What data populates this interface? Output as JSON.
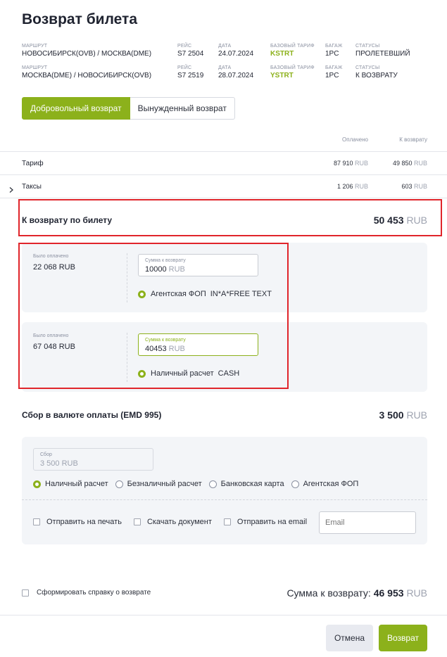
{
  "title": "Возврат билета",
  "flights": [
    {
      "route_label": "МАРШРУТ",
      "route": "НОВОСИБИРСК(OVB) / МОСКВА(DME)",
      "flight_label": "РЕЙС",
      "flight": "S7 2504",
      "date_label": "ДАТА",
      "date": "24.07.2024",
      "fare_label": "БАЗОВЫЙ ТАРИФ",
      "fare": "KSTRT",
      "baggage_label": "БАГАЖ",
      "baggage": "1PC",
      "status_label": "СТАТУСЫ",
      "status": "ПРОЛЕТЕВШИЙ"
    },
    {
      "route_label": "МАРШРУТ",
      "route": "МОСКВА(DME) / НОВОСИБИРСК(OVB)",
      "flight_label": "РЕЙС",
      "flight": "S7 2519",
      "date_label": "ДАТА",
      "date": "28.07.2024",
      "fare_label": "БАЗОВЫЙ ТАРИФ",
      "fare": "YSTRT",
      "baggage_label": "БАГАЖ",
      "baggage": "1PC",
      "status_label": "СТАТУСЫ",
      "status": "К ВОЗВРАТУ"
    }
  ],
  "tabs": {
    "voluntary": "Добровольный возврат",
    "forced": "Вынужденный возврат"
  },
  "table": {
    "col_paid": "Оплачено",
    "col_refund": "К возврату",
    "rows": [
      {
        "name": "Тариф",
        "paid": "87 910",
        "refund": "49 850"
      },
      {
        "name": "Таксы",
        "paid": "1 206",
        "refund": "603"
      }
    ],
    "currency": "RUB"
  },
  "ticket_refund": {
    "label": "К возврату по билету",
    "amount": "50 453",
    "currency": "RUB"
  },
  "payments": [
    {
      "paid_label": "Было оплачено",
      "paid": "22 068 RUB",
      "input_label": "Сумма к возврату",
      "input_value": "10000",
      "input_currency": "RUB",
      "method": "Агентская ФОП",
      "method_code": "IN*A*FREE TEXT"
    },
    {
      "paid_label": "Было оплачено",
      "paid": "67 048 RUB",
      "input_label": "Сумма к возврату",
      "input_value": "40453",
      "input_currency": "RUB",
      "method": "Наличный расчет",
      "method_code": "CASH"
    }
  ],
  "emd": {
    "label": "Сбор в валюте оплаты (EMD 995)",
    "amount": "3 500",
    "currency": "RUB",
    "fee_label": "Сбор",
    "fee_value": "3 500 RUB",
    "options": [
      "Наличный расчет",
      "Безналичный расчет",
      "Банковская карта",
      "Агентская ФОП"
    ],
    "send_print": "Отправить на печать",
    "download": "Скачать документ",
    "send_email": "Отправить на email",
    "email_placeholder": "Email"
  },
  "footer": {
    "certificate": "Сформировать справку о возврате",
    "total_label": "Сумма к возврату:",
    "total_amount": "46 953",
    "total_currency": "RUB",
    "cancel": "Отмена",
    "submit": "Возврат"
  },
  "colors": {
    "accent": "#8cb11b",
    "highlight": "#e0252b"
  }
}
